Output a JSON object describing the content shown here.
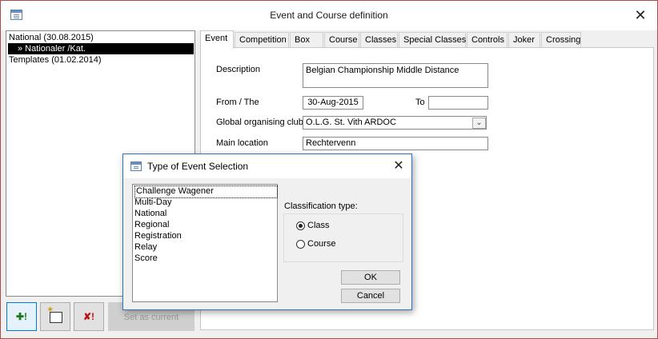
{
  "window": {
    "title": "Event and Course definition"
  },
  "tree": {
    "items": [
      {
        "label": "National (30.08.2015)"
      },
      {
        "label": "» Nationaler /Kat."
      },
      {
        "label": "Templates (01.02.2014)"
      }
    ]
  },
  "toolbar": {
    "add_label": "✚!",
    "edit_label": "",
    "delete_label": "✘!",
    "set_current_label": "Set as current"
  },
  "tabs": [
    "Event",
    "Competition",
    "Box",
    "Course",
    "Classes",
    "Special Classes",
    "Controls",
    "Joker",
    "Crossing"
  ],
  "event_form": {
    "description_label": "Description",
    "description_value": "Belgian Championship Middle Distance",
    "from_label": "From / The",
    "from_value": "30-Aug-2015",
    "to_label": "To",
    "to_value": "",
    "club_label": "Global organising club",
    "club_value": "O.L.G. St. Vith ARDOC",
    "location_label": "Main location",
    "location_value": "Rechtervenn"
  },
  "dialog": {
    "title": "Type of Event Selection",
    "list_items": [
      "Challenge Wagener",
      "Multi-Day",
      "National",
      "Regional",
      "Registration",
      "Relay",
      "Score"
    ],
    "classification_label": "Classification type:",
    "radio_class": "Class",
    "radio_course": "Course",
    "selected": "Class",
    "ok_label": "OK",
    "cancel_label": "Cancel"
  },
  "colors": {
    "window_border": "#b34a4a",
    "dialog_border": "#2c73c5",
    "selection_bg": "#000000"
  }
}
